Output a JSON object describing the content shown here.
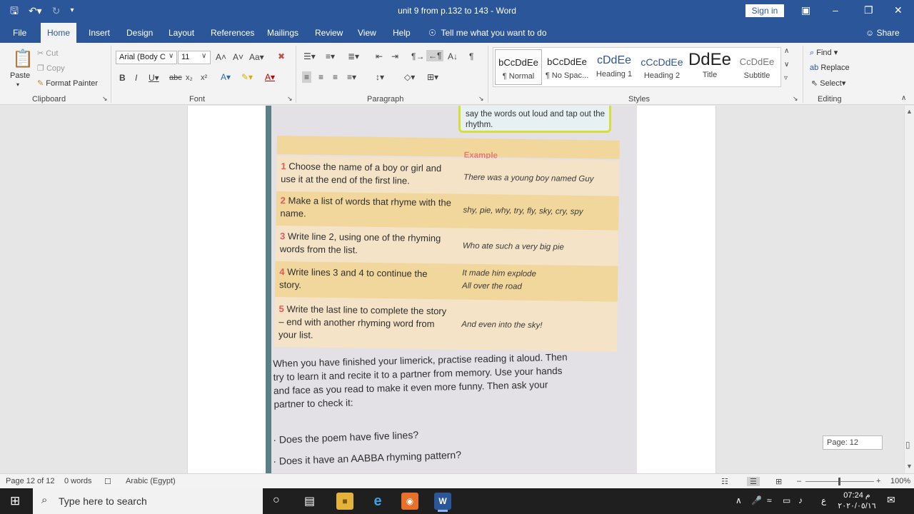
{
  "window": {
    "title": "unit 9 from p.132 to 143  -  Word",
    "sign_in": "Sign in",
    "share": "Share"
  },
  "tabs": [
    "File",
    "Home",
    "Insert",
    "Design",
    "Layout",
    "References",
    "Mailings",
    "Review",
    "View",
    "Help"
  ],
  "tell_me": "Tell me what you want to do",
  "ribbon": {
    "clipboard": {
      "paste": "Paste",
      "cut": "Cut",
      "copy": "Copy",
      "format_painter": "Format Painter",
      "label": "Clipboard"
    },
    "font": {
      "name": "Arial (Body C",
      "size": "11",
      "label": "Font"
    },
    "paragraph": {
      "label": "Paragraph"
    },
    "styles": {
      "label": "Styles",
      "items": [
        {
          "sample": "bCcDdEe",
          "name": "¶ Normal"
        },
        {
          "sample": "bCcDdEe",
          "name": "¶ No Spac..."
        },
        {
          "sample": "cDdEe",
          "name": "Heading 1"
        },
        {
          "sample": "cCcDdEe",
          "name": "Heading 2"
        },
        {
          "sample": "DdEe",
          "name": "Title"
        },
        {
          "sample": "CcDdEe",
          "name": "Subtitle"
        }
      ]
    },
    "editing": {
      "find": "Find",
      "replace": "Replace",
      "select": "Select",
      "label": "Editing"
    }
  },
  "document": {
    "callout": "say the words out loud and tap out the rhythm.",
    "example_header": "Example",
    "steps": [
      {
        "num": "1",
        "text": "Choose the name of a boy or girl and use it at the end of the first line.",
        "example": "There was a young boy named Guy"
      },
      {
        "num": "2",
        "text": "Make a list of words that rhyme with the name.",
        "example": "shy, pie, why, try, fly, sky, cry, spy"
      },
      {
        "num": "3",
        "text": "Write line 2, using one of the rhyming words from the list.",
        "example": "Who ate such a very big pie"
      },
      {
        "num": "4",
        "text": "Write lines 3 and 4 to continue the story.",
        "example": "It made him explode All over the road"
      },
      {
        "num": "5",
        "text": "Write the last line to complete the story – end with another rhyming word from your list.",
        "example": "And even into the sky!"
      }
    ],
    "paragraph": "When you have finished your limerick, practise reading it aloud. Then try to learn it and recite it to a partner from memory. Use your hands and face as you read to make it even more funny. Then ask your partner to check it:",
    "bullets": [
      "Does the poem have five lines?",
      "Does it have an AABBA rhyming pattern?"
    ]
  },
  "page_tip": "Page: 12",
  "status": {
    "page": "Page 12 of 12",
    "words": "0 words",
    "language": "Arabic (Egypt)",
    "zoom": "100%",
    "zoom_level": 1.0
  },
  "taskbar": {
    "search_placeholder": "Type here to search",
    "time": "07:24 م",
    "date": "٢٠٢٠/٠٥/١٦",
    "ime": "ع"
  }
}
